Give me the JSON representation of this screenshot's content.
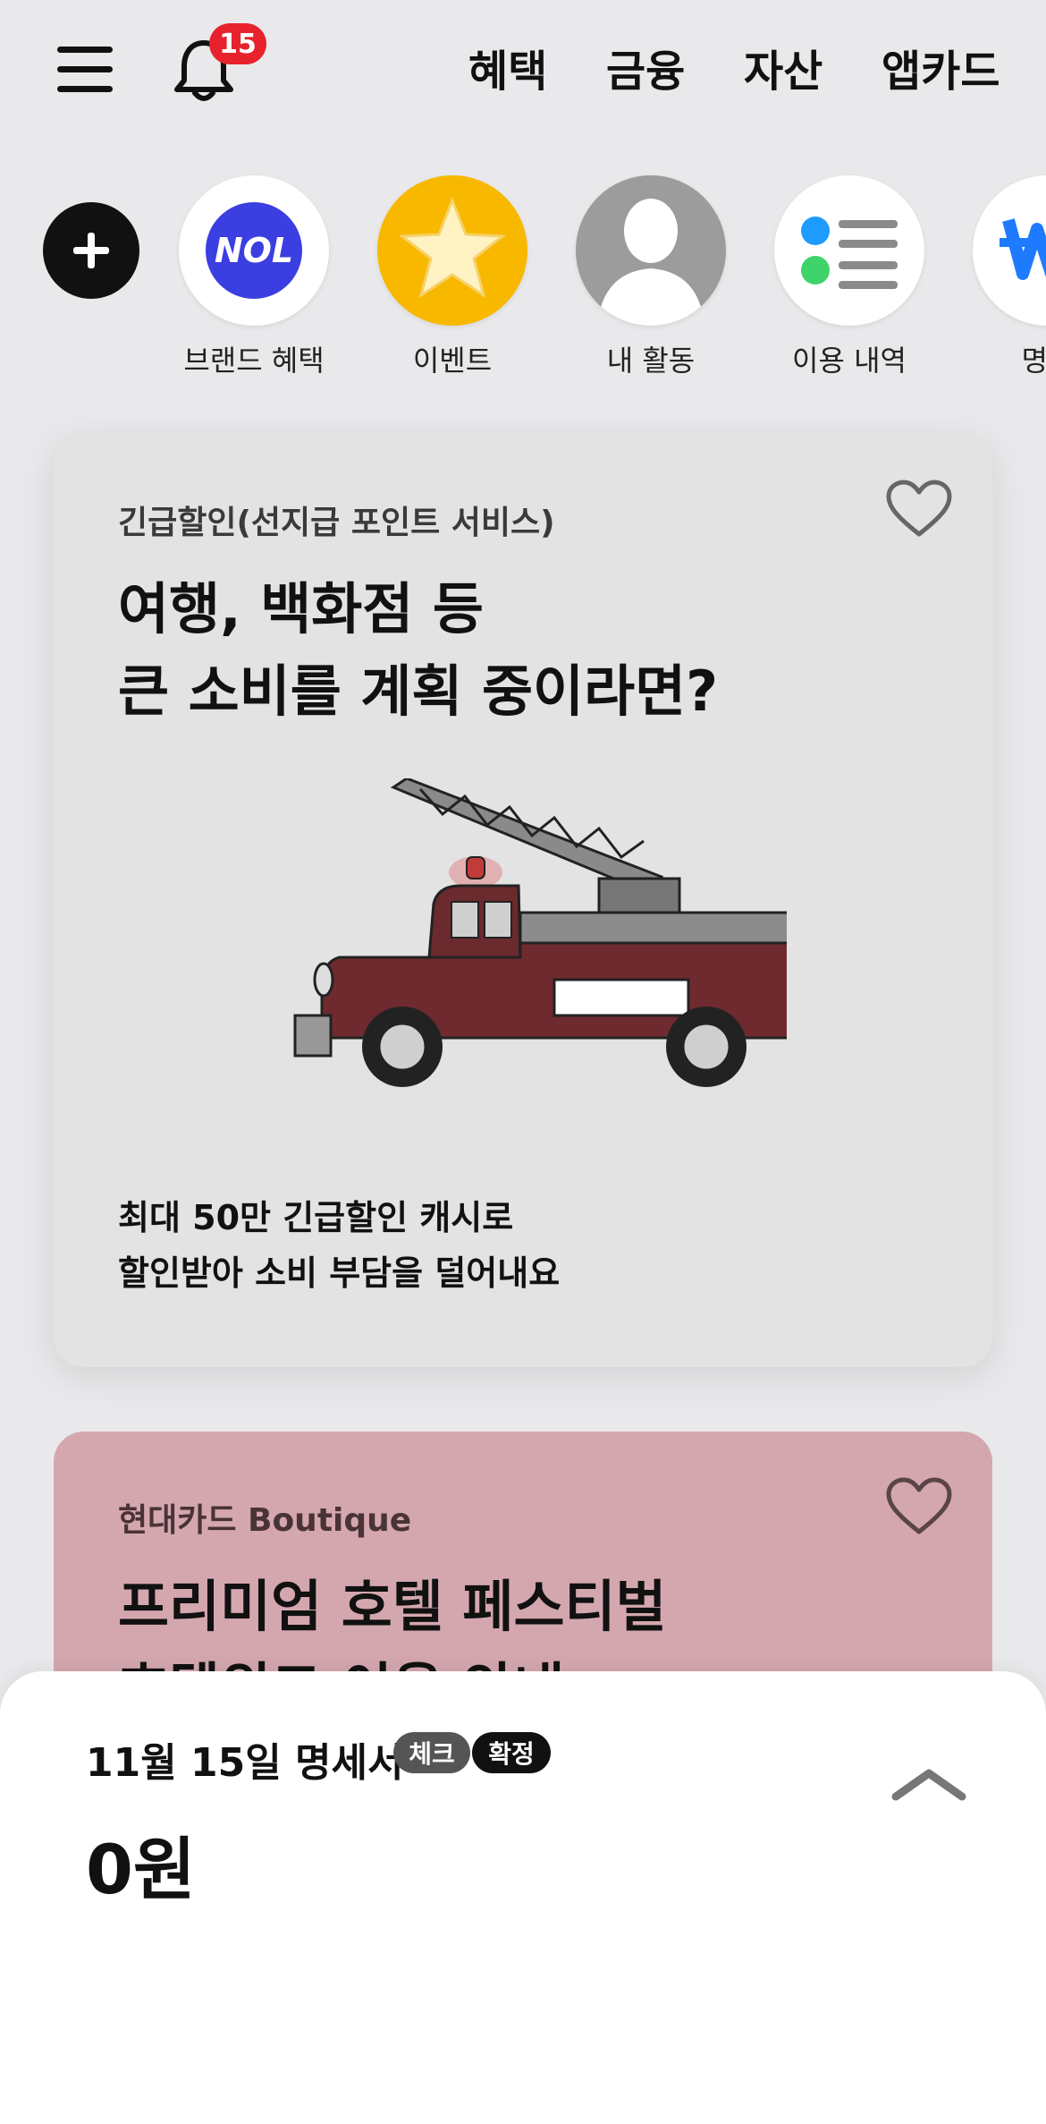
{
  "header": {
    "notification_count": "15",
    "tabs": [
      "혜택",
      "금융",
      "자산",
      "앱카드"
    ]
  },
  "quick_menu": {
    "items": [
      {
        "label": "브랜드 혜택",
        "icon": "nol-logo-icon"
      },
      {
        "label": "이벤트",
        "icon": "star-icon"
      },
      {
        "label": "내 활동",
        "icon": "person-icon"
      },
      {
        "label": "이용 내역",
        "icon": "list-icon"
      },
      {
        "label": "명세",
        "icon": "statement-icon"
      }
    ],
    "nol_logo_text": "NOL"
  },
  "cards": [
    {
      "category": "긴급할인(선지급 포인트 서비스)",
      "title_line1": "여행, 백화점 등",
      "title_line2": "큰 소비를 계획 중이라면?",
      "desc_line1": "최대 50만 긴급할인 캐시로",
      "desc_line2": "할인받아 소비 부담을 덜어내요",
      "bg_color": "#e3e3e3"
    },
    {
      "category": "현대카드 Boutique",
      "title_line1": "프리미엄 호텔 페스티벌",
      "title_line2": "호텔위크 이용 안내",
      "bg_color": "#d4a7af"
    }
  ],
  "statement": {
    "title": "11월 15일 명세서",
    "chip_check": "체크",
    "chip_confirmed": "확정",
    "amount": "0원"
  },
  "colors": {
    "badge": "#e8222c",
    "nol_blue": "#3b3ee0",
    "star_yellow": "#f7b500"
  }
}
